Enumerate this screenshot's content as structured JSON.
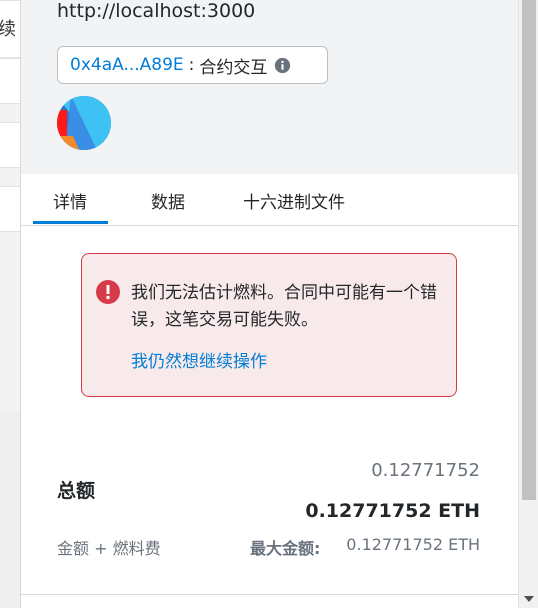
{
  "background": {
    "partial_text": "续"
  },
  "header": {
    "origin": "http://localhost:3000",
    "contract_address": "0x4aA...A89E",
    "separator": ":",
    "interaction_type": "合约交互"
  },
  "tabs": [
    {
      "label": "详情",
      "active": true
    },
    {
      "label": "数据",
      "active": false
    },
    {
      "label": "十六进制文件",
      "active": false
    }
  ],
  "error": {
    "message": "我们无法估计燃料。合同中可能有一个错误，这笔交易可能失败。",
    "link": "我仍然想继续操作",
    "color": "#d73a49"
  },
  "totals": {
    "label": "总额",
    "amount_top": "0.12771752",
    "amount_main": "0.12771752 ETH",
    "sub_label": "金额 + 燃料费",
    "max_label": "最大金额:",
    "max_value": "0.12771752 ETH"
  },
  "colors": {
    "accent": "#037dd6",
    "error": "#d73a49",
    "header_bg": "#f2f3f4"
  }
}
